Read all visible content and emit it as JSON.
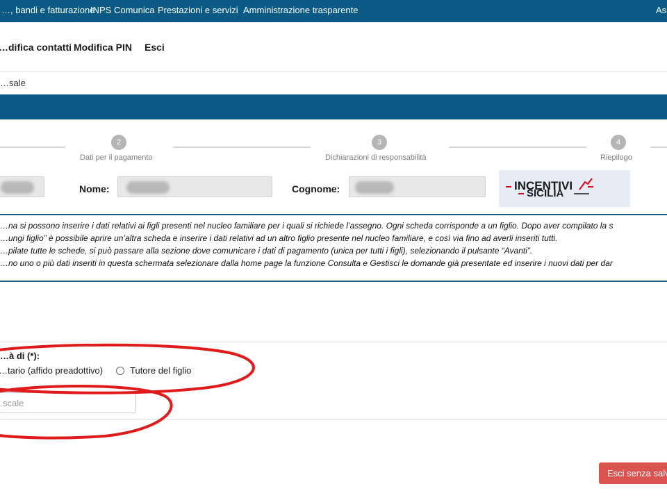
{
  "top_nav": {
    "items": [
      "…, bandi e fatturazione",
      "INPS Comunica",
      "Prestazioni e servizi",
      "Amministrazione trasparente",
      "Ass"
    ]
  },
  "user_menu": {
    "items": [
      "…difica contatti",
      "Modifica PIN",
      "Esci"
    ]
  },
  "breadcrumb": "…sale",
  "stepper": {
    "steps": [
      {
        "number": "2",
        "label": "Dati per il pagamento"
      },
      {
        "number": "3",
        "label": "Dichiarazioni di responsabilità"
      },
      {
        "number": "4",
        "label": "Riepilogo"
      }
    ]
  },
  "applicant": {
    "nome_label": "Nome:",
    "cognome_label": "Cognome:",
    "logo_text": {
      "line1": "INCENTIVI",
      "line2": "SICILIA"
    }
  },
  "info_box": {
    "lines": [
      "…na si possono inserire i dati relativi ai figli presenti nel nucleo familiare per i quali si richiede l’assegno. Ogni scheda corrisponde a un figlio. Dopo aver compilato la s",
      "…ungi figlio” è possibile aprire un’altra scheda e inserire i dati relativi ad un altro figlio presente nel nucleo familiare, e così via fino ad averli inseriti tutti.",
      "…pilate tutte le schede, si può passare alla sezione dove comunicare i dati di pagamento (unica per tutti i figli), selezionando il pulsante “Avanti”.",
      "…no uno o più dati inseriti in questa schermata selezionare dalla home page la funzione Consulta e Gestisci le domande già presentate ed inserire i nuovi dati per dar"
    ]
  },
  "form": {
    "qualita_label": "…à di (*):",
    "option_affidatario": "…tario (affido preadottivo)",
    "option_tutore": "Tutore del figlio",
    "codice_fiscale_placeholder": "…scale"
  },
  "buttons": {
    "exit_without_save": "Esci senza salv"
  },
  "colors": {
    "header_blue": "#0a5a85",
    "danger_red": "#d9534f",
    "annotation_red": "#e01b1b"
  }
}
